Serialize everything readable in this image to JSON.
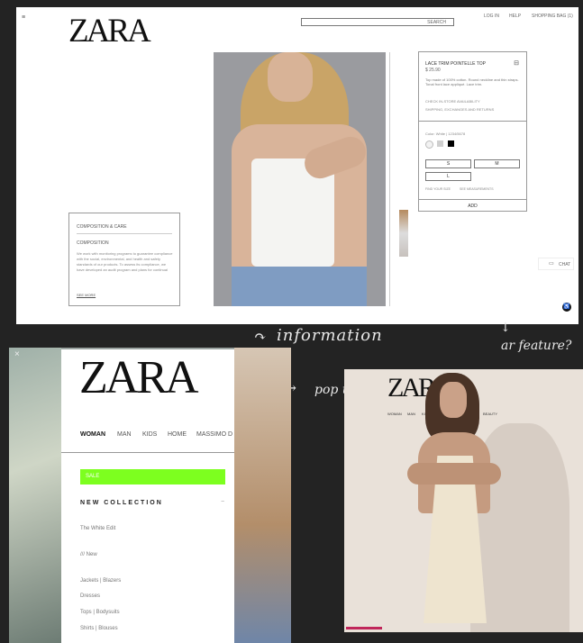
{
  "top": {
    "logo": "ZARA",
    "search_label": "SEARCH",
    "login": "LOG IN",
    "help": "HELP",
    "bag": "SHOPPING BAG (1)",
    "product": {
      "name": "LACE TRIM POINTELLE TOP",
      "price": "$ 25.90",
      "desc": "Top made of 100% cotton. Round neckline and thin straps. Tonal front lace appliqué. Lace trim.",
      "store_link": "CHECK IN-STORE AVAILABILITY",
      "shipping_link": "SHIPPING, EXCHANGES AND RETURNS",
      "color_label": "Color: White | 1234/5678",
      "sizes": [
        "S",
        "M",
        "L"
      ],
      "size_guide": "FIND YOUR SIZE",
      "measurements": "SEE MEASUREMENTS",
      "add_label": "ADD"
    },
    "composition": {
      "heading": "COMPOSITION & CARE",
      "sub": "COMPOSITION",
      "text": "We work with monitoring programs to guarantee compliance with the social, environmental, and health and safety standards of our products. To assess its compliance, we have developed an audit program and plans for continual",
      "link": "SEE MORE"
    },
    "chat_label": "CHAT",
    "swatch_colors": [
      "#f2f2f2",
      "#cfcfcf",
      "#000000"
    ]
  },
  "annotations": {
    "information": "information",
    "ar_feature": "ar feature?",
    "pop_up": "pop up"
  },
  "menu": {
    "logo": "ZARA",
    "tabs": [
      "WOMAN",
      "MAN",
      "KIDS",
      "HOME",
      "MASSIMO D"
    ],
    "sale": "SALE",
    "new_collection": "NEW COLLECTION",
    "items": [
      "The White Edit",
      "/// New",
      "Jackets | Blazers",
      "Dresses",
      "Tops | Bodysuits",
      "Shirts | Blouses"
    ],
    "accent": "#7dff1f"
  },
  "popup": {
    "logo": "ZARA",
    "nav": [
      "WOMAN",
      "MAN",
      "KIDS",
      "HOME",
      "BEAUTY"
    ]
  }
}
